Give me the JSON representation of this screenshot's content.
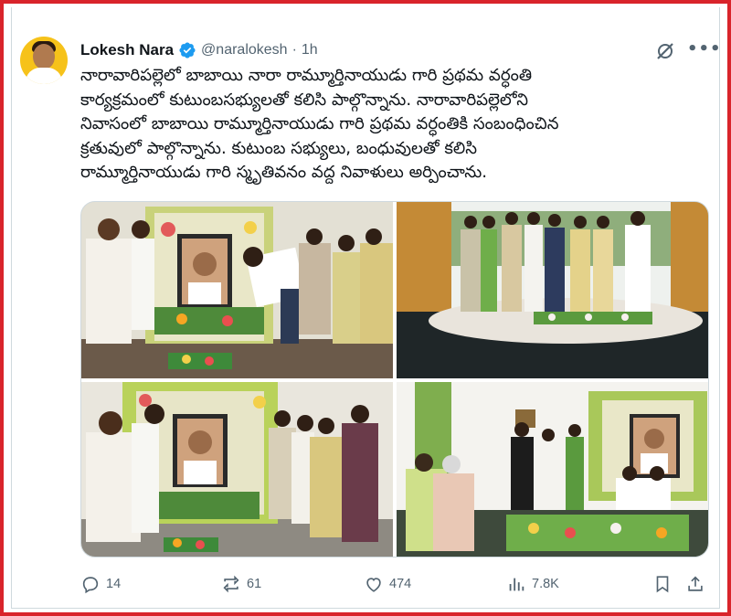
{
  "tweet": {
    "author_name": "Lokesh Nara",
    "handle": "@naralokesh",
    "separator": "·",
    "time": "1h",
    "text_lines": [
      "నారావారిపల్లెలో బాబాయి నారా రామ్మూర్తినాయుడు గారి ప్రథమ వర్ధంతి",
      "కార్యక్రమంలో కుటుంబసభ్యులతో కలిసి పాల్గొన్నాను. నారావారిపల్లెలోని",
      "నివాసంలో బాబాయి రామ్మూర్తినాయుడు గారి ప్రథమ వర్ధంతికి సంబంధించిన",
      "క్రతువులో పాల్గొన్నాను. కుటుంబ సభ్యులు, బంధువులతో కలిసి",
      "రామ్మూర్తినాయుడు గారి స్మృతివనం వద్ద నివాళులు అర్పించాను."
    ],
    "media": [
      {
        "description": "photo-ritual-bow"
      },
      {
        "description": "photo-memorial-pool"
      },
      {
        "description": "photo-family-tribute"
      },
      {
        "description": "photo-home-ceremony"
      }
    ],
    "stats": {
      "replies": "14",
      "reposts": "61",
      "likes": "474",
      "views": "7.8K"
    }
  },
  "icons": {
    "verified": "verified-badge-icon",
    "grok": "grok-icon",
    "more": "more-icon",
    "reply": "reply-icon",
    "repost": "repost-icon",
    "like": "like-icon",
    "views": "views-icon",
    "bookmark": "bookmark-icon",
    "share": "share-icon"
  },
  "colors": {
    "frame": "#d9242b",
    "verified": "#1d9bf0",
    "muted": "#536471",
    "avatar_bg": "#f6c21a"
  }
}
